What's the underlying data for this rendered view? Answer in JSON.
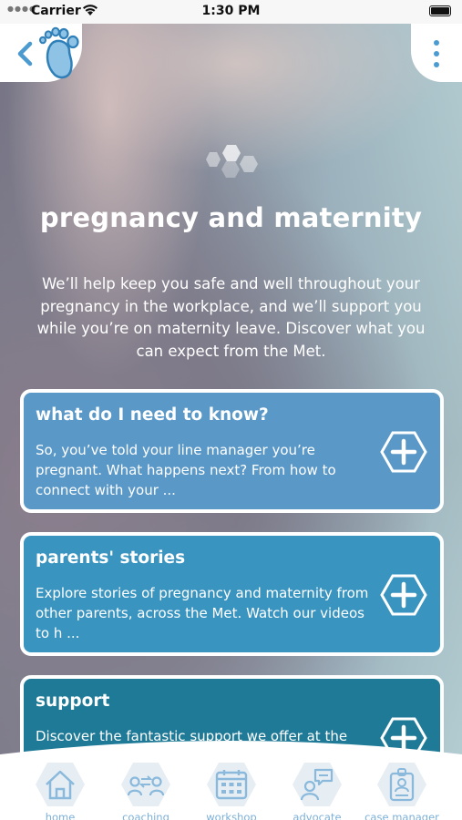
{
  "status_bar": {
    "carrier": "Carrier",
    "time": "1:30 PM"
  },
  "header": {
    "back_icon": "chevron-left-icon",
    "logo_icon": "baby-foot-icon",
    "menu_icon": "vertical-dots-icon"
  },
  "hero": {
    "title": "pregnancy and maternity",
    "intro": "We’ll help keep you safe and well throughout your pregnancy in the workplace, and we’ll support you while you’re on maternity leave. Discover what you can expect from the Met."
  },
  "cards": [
    {
      "title": "what do I need to know?",
      "body": "So, you’ve told your line manager you’re pregnant. What happens next? From how to connect with your ...",
      "color": "#5a98c8"
    },
    {
      "title": "parents' stories",
      "body": "Explore stories of pregnancy and maternity from other parents, across the Met. Watch our videos to h ...",
      "color": "#3a94c0"
    },
    {
      "title": "support",
      "body": "Discover the fantastic support we offer at the",
      "color": "#1e7a96"
    }
  ],
  "tabs": [
    {
      "label": "home",
      "icon": "home-icon"
    },
    {
      "label": "coaching",
      "icon": "coaching-icon"
    },
    {
      "label": "workshop",
      "icon": "calendar-icon"
    },
    {
      "label": "advocate",
      "icon": "advocate-chat-icon"
    },
    {
      "label": "case manager",
      "icon": "id-badge-icon"
    }
  ],
  "colors": {
    "accent": "#4b9bd0",
    "tab_label": "#7cb0d8"
  }
}
